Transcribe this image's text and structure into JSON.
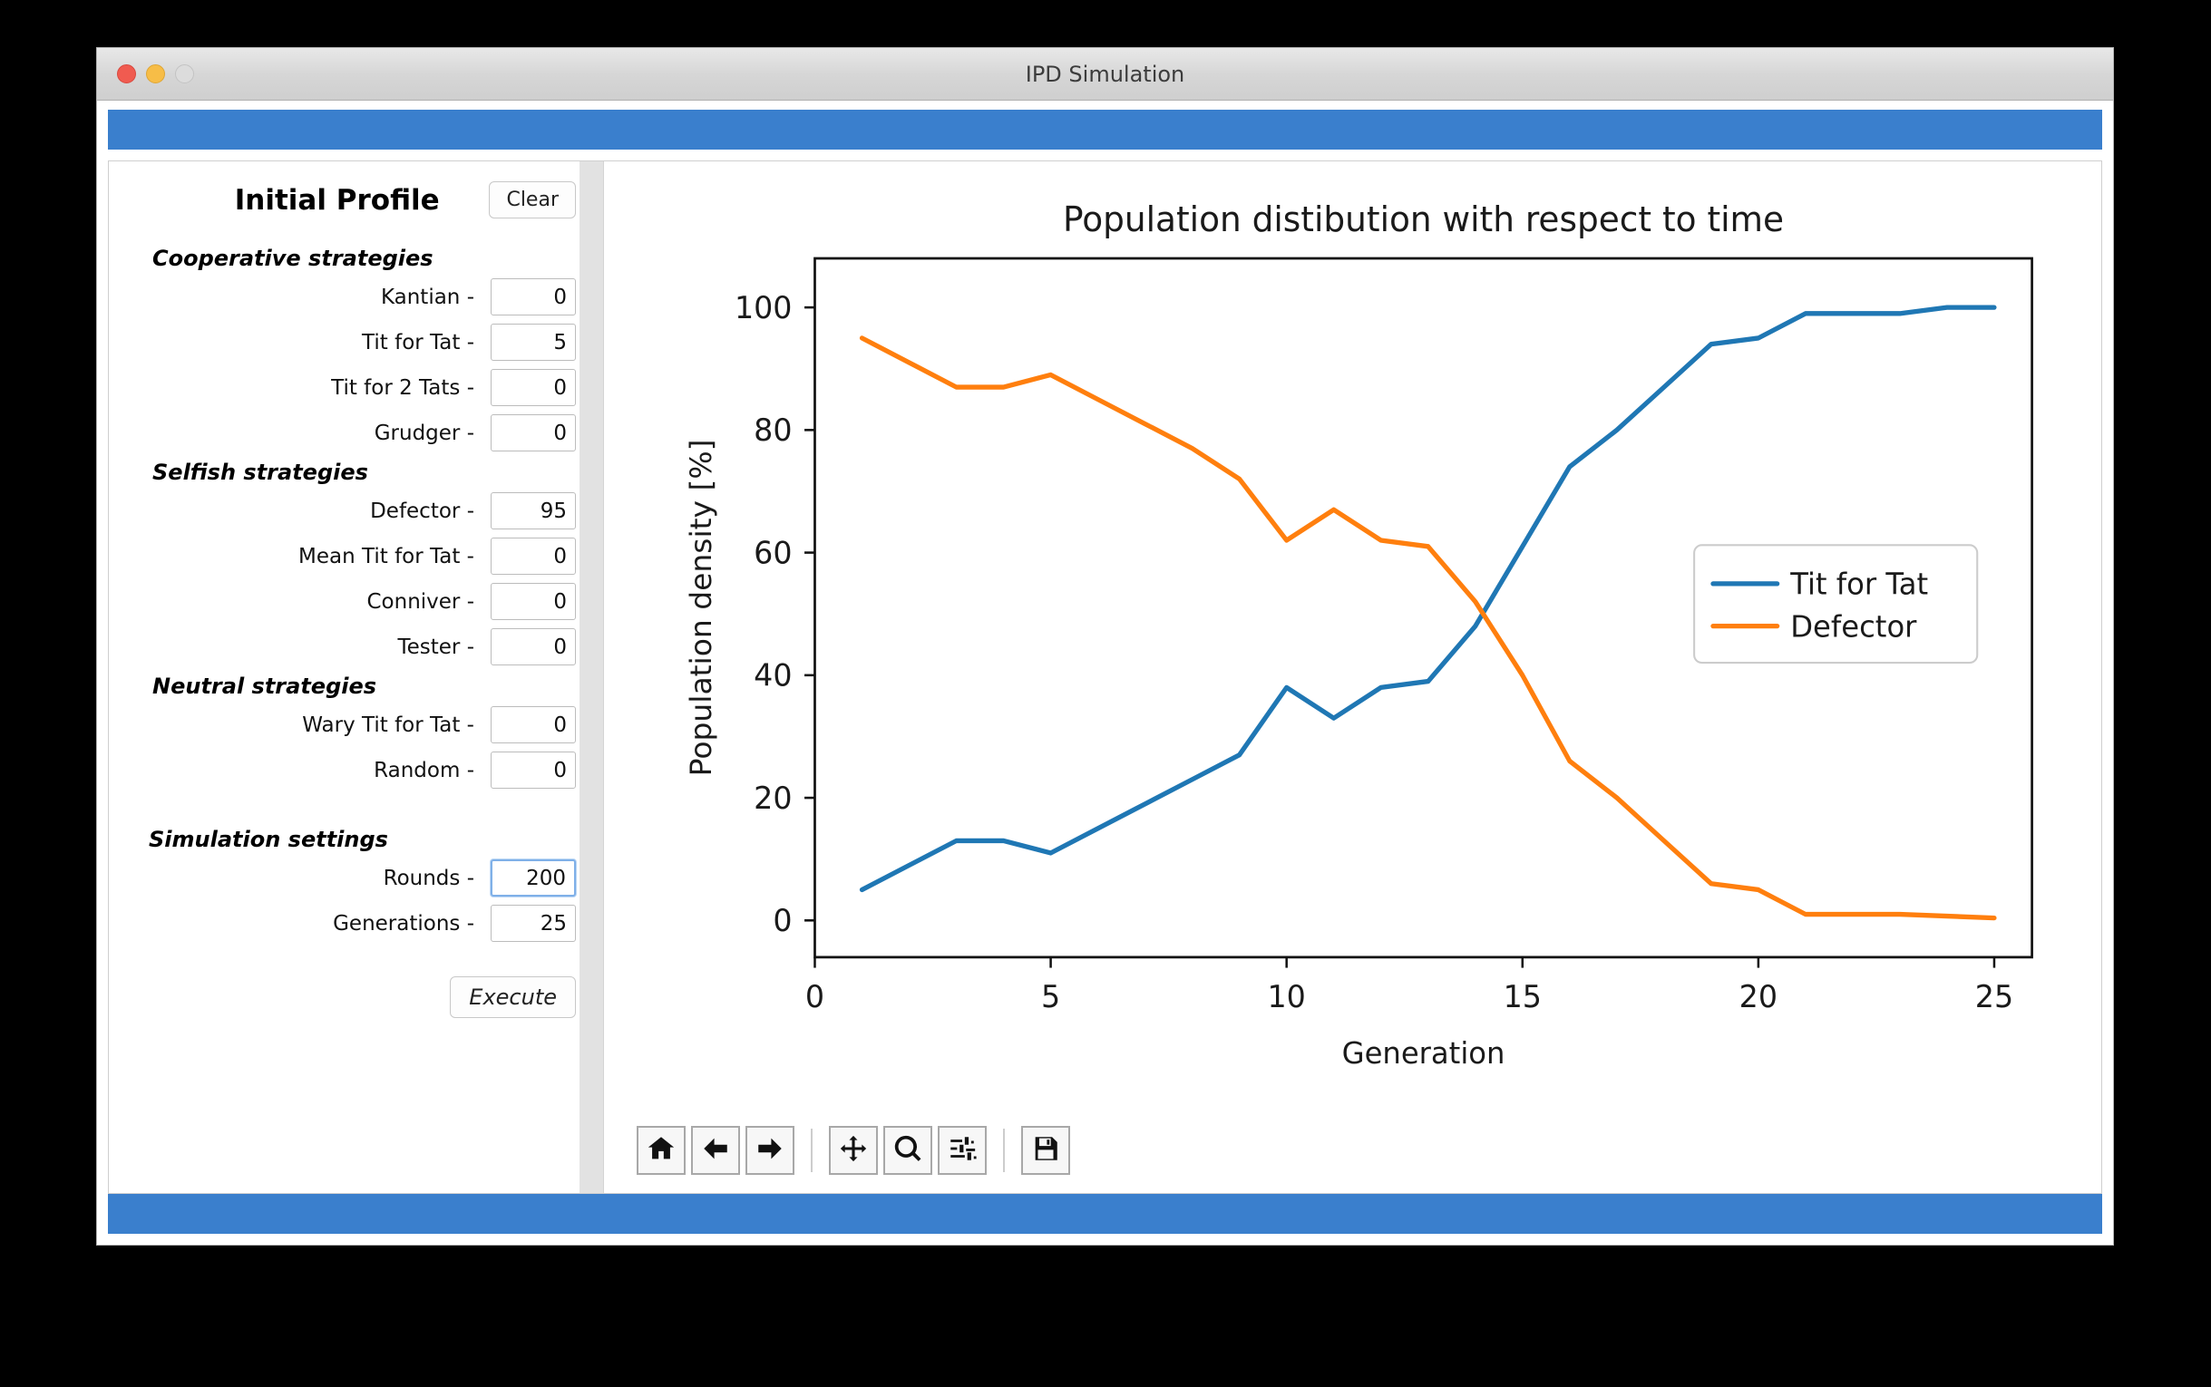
{
  "window": {
    "title": "IPD Simulation",
    "traffic_lights": [
      "close",
      "minimize",
      "zoom"
    ],
    "accent_color": "#3a7fcd"
  },
  "sidebar": {
    "panel_title": "Initial Profile",
    "clear_label": "Clear",
    "execute_label": "Execute",
    "groups": [
      {
        "title": "Cooperative strategies",
        "rows": [
          {
            "label": "Kantian -",
            "value": "0"
          },
          {
            "label": "Tit for Tat -",
            "value": "5"
          },
          {
            "label": "Tit for 2 Tats -",
            "value": "0"
          },
          {
            "label": "Grudger -",
            "value": "0"
          }
        ]
      },
      {
        "title": "Selfish strategies",
        "rows": [
          {
            "label": "Defector -",
            "value": "95"
          },
          {
            "label": "Mean Tit for Tat -",
            "value": "0"
          },
          {
            "label": "Conniver -",
            "value": "0"
          },
          {
            "label": "Tester -",
            "value": "0"
          }
        ]
      },
      {
        "title": "Neutral strategies",
        "rows": [
          {
            "label": "Wary Tit for Tat -",
            "value": "0"
          },
          {
            "label": "Random -",
            "value": "0"
          }
        ]
      }
    ],
    "simulation": {
      "title": "Simulation settings",
      "rows": [
        {
          "label": "Rounds -",
          "value": "200",
          "focused": true
        },
        {
          "label": "Generations -",
          "value": "25",
          "focused": false
        }
      ]
    }
  },
  "toolbar": {
    "buttons": [
      {
        "name": "home-icon",
        "tooltip": "Reset original view"
      },
      {
        "name": "arrow-left-icon",
        "tooltip": "Back to previous view"
      },
      {
        "name": "arrow-right-icon",
        "tooltip": "Forward to next view"
      },
      {
        "name": "move-icon",
        "tooltip": "Pan axes with left mouse, zoom with right"
      },
      {
        "name": "magnifier-icon",
        "tooltip": "Zoom to rectangle"
      },
      {
        "name": "sliders-icon",
        "tooltip": "Configure subplots"
      },
      {
        "name": "floppy-disk-icon",
        "tooltip": "Save the figure"
      }
    ]
  },
  "chart_data": {
    "type": "line",
    "title": "Population distibution with respect to time",
    "xlabel": "Generation",
    "ylabel": "Population density [%]",
    "xlim": [
      0,
      25.8
    ],
    "ylim": [
      -6,
      108
    ],
    "xticks": [
      0,
      5,
      10,
      15,
      20,
      25
    ],
    "yticks": [
      0,
      20,
      40,
      60,
      80,
      100
    ],
    "grid": false,
    "legend_position": "center right",
    "x": [
      1,
      2,
      3,
      4,
      5,
      6,
      7,
      8,
      9,
      10,
      11,
      12,
      13,
      14,
      15,
      16,
      17,
      18,
      19,
      20,
      21,
      22,
      23,
      24,
      25
    ],
    "series": [
      {
        "name": "Tit for Tat",
        "color": "#1f77b4",
        "values": [
          5,
          9,
          13,
          13,
          11,
          15,
          19,
          23,
          27,
          38,
          33,
          38,
          39,
          48,
          61,
          74,
          80,
          87,
          94,
          95,
          99,
          99,
          99,
          100,
          100
        ]
      },
      {
        "name": "Defector",
        "color": "#ff7f0e",
        "values": [
          95,
          91,
          87,
          87,
          89,
          85,
          81,
          77,
          72,
          62,
          67,
          62,
          61,
          52,
          40,
          26,
          20,
          13,
          6,
          5,
          1,
          1,
          1,
          0.7,
          0.4
        ]
      }
    ]
  }
}
